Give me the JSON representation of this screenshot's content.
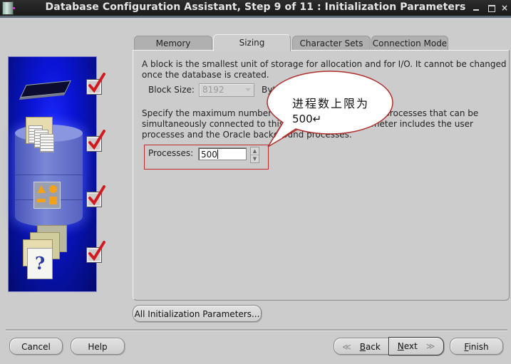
{
  "window": {
    "title": "Database Configuration Assistant, Step 9 of 11 : Initialization Parameters",
    "controls": {
      "minimize": "minimize",
      "maximize": "maximize",
      "close": "×"
    }
  },
  "sidebar": {
    "steps": [
      {
        "icon": "memory-chip-icon",
        "checked": true
      },
      {
        "icon": "documents-folder-icon",
        "checked": true
      },
      {
        "icon": "shapes-icon",
        "checked": true
      },
      {
        "icon": "help-document-icon",
        "checked": true
      }
    ]
  },
  "tabs": [
    {
      "label": "Memory",
      "active": false
    },
    {
      "label": "Sizing",
      "active": true
    },
    {
      "label": "Character Sets",
      "active": false
    },
    {
      "label": "Connection Mode",
      "active": false
    }
  ],
  "sizing": {
    "block_description_line1": "A block is the smallest unit of storage for allocation and for I/O. It cannot be changed",
    "block_description_line2": "once the database is created.",
    "block_size_label": "Block Size:",
    "block_size_value": "8192",
    "block_size_unit": "Bytes",
    "processes_description_line1": "Specify the maximum number of operating system user processes that can be",
    "processes_description_line2": "simultaneously connected to this database. This parameter includes the user",
    "processes_description_line3": "processes and the Oracle background processes.",
    "processes_label": "Processes:",
    "processes_value": "500"
  },
  "annotation": {
    "line1": "进程数上限为",
    "line2": "500↵",
    "border_color": "#b03030"
  },
  "buttons": {
    "all_params": "All Initialization Parameters...",
    "cancel": "Cancel",
    "help": "Help",
    "back_arrow": "≪",
    "back_mnemonic": "B",
    "back_rest": "ack",
    "next_mnemonic": "N",
    "next_rest": "ext",
    "next_arrow": "≫",
    "finish_mnemonic": "F",
    "finish_rest": "inish"
  }
}
